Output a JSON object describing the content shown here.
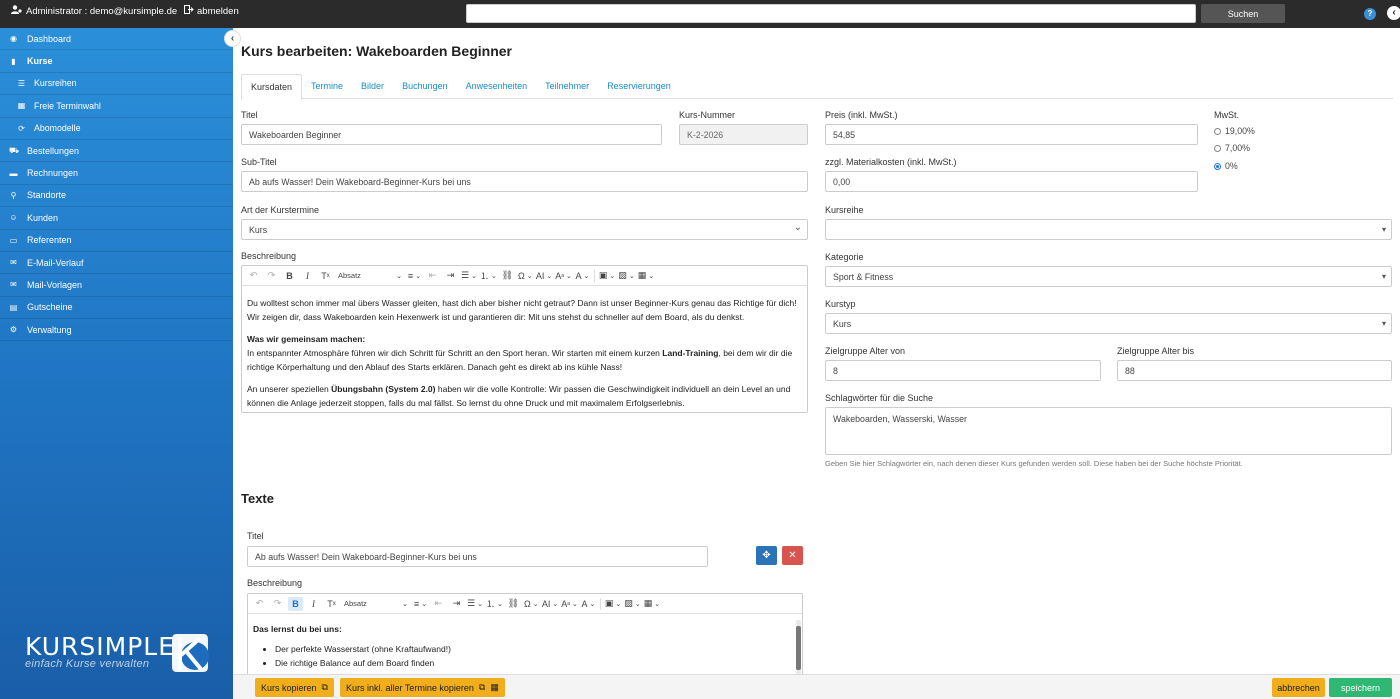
{
  "topbar": {
    "user": "Administrator : demo@kursimple.de",
    "logout": "abmelden",
    "search_placeholder": "",
    "search_button": "Suchen",
    "help_glyph": "?",
    "collapse_glyph": "‹"
  },
  "sidebar": {
    "collapse_glyph": "‹",
    "items": [
      {
        "label": "Dashboard",
        "icon": "dashboard-icon",
        "glyph": "◉"
      },
      {
        "label": "Kurse",
        "icon": "book-icon",
        "glyph": "▮"
      },
      {
        "label": "Kursreihen",
        "icon": "list-icon",
        "glyph": "☰"
      },
      {
        "label": "Freie Terminwahl",
        "icon": "calendar-icon",
        "glyph": "▦"
      },
      {
        "label": "Abomodelle",
        "icon": "refresh-icon",
        "glyph": "⟳"
      },
      {
        "label": "Bestellungen",
        "icon": "cart-icon",
        "glyph": "⛟"
      },
      {
        "label": "Rechnungen",
        "icon": "invoice-icon",
        "glyph": "▬"
      },
      {
        "label": "Standorte",
        "icon": "map-marker-icon",
        "glyph": "⚲"
      },
      {
        "label": "Kunden",
        "icon": "users-icon",
        "glyph": "☺"
      },
      {
        "label": "Referenten",
        "icon": "id-card-icon",
        "glyph": "▭"
      },
      {
        "label": "E-Mail-Verlauf",
        "icon": "envelope-icon",
        "glyph": "✉"
      },
      {
        "label": "Mail-Vorlagen",
        "icon": "inbox-icon",
        "glyph": "✉"
      },
      {
        "label": "Gutscheine",
        "icon": "ticket-icon",
        "glyph": "▤"
      },
      {
        "label": "Verwaltung",
        "icon": "gear-icon",
        "glyph": "⚙"
      }
    ],
    "logo_word": "KURSIMPLE",
    "logo_tagline": "einfach Kurse verwalten"
  },
  "page": {
    "title": "Kurs bearbeiten: Wakeboarden Beginner",
    "tabs": [
      "Kursdaten",
      "Termine",
      "Bilder",
      "Buchungen",
      "Anwesenheiten",
      "Teilnehmer",
      "Reservierungen"
    ]
  },
  "form": {
    "titel_label": "Titel",
    "titel_value": "Wakeboarden Beginner",
    "kursnummer_label": "Kurs-Nummer",
    "kursnummer_value": "K-2-2026",
    "subtitel_label": "Sub-Titel",
    "subtitel_value": "Ab aufs Wasser! Dein Wakeboard-Beginner-Kurs bei uns",
    "art_label": "Art der Kurstermine",
    "art_value": "Kurs",
    "beschreibung_label": "Beschreibung",
    "preis_label": "Preis (inkl. MwSt.)",
    "preis_value": "54,85",
    "material_label": "zzgl. Materialkosten (inkl. MwSt.)",
    "material_value": "0,00",
    "mwst_label": "MwSt.",
    "mwst_options": [
      "19,00%",
      "7,00%",
      "0%"
    ],
    "kursreihe_label": "Kursreihe",
    "kursreihe_value": "",
    "kategorie_label": "Kategorie",
    "kategorie_value": "Sport & Fitness",
    "kurstyp_label": "Kurstyp",
    "kurstyp_value": "Kurs",
    "alter_von_label": "Zielgruppe Alter von",
    "alter_von_value": "8",
    "alter_bis_label": "Zielgruppe Alter bis",
    "alter_bis_value": "88",
    "schlag_label": "Schlagwörter für die Suche",
    "schlag_value": "Wakeboarden, Wasserski, Wasser",
    "schlag_hint": "Geben Sie hier Schlagwörter ein, nach denen dieser Kurs gefunden werden soll. Diese haben bei der Suche höchste Priorität."
  },
  "editor": {
    "format": "Absatz",
    "p1": "Du wolltest schon immer mal übers Wasser gleiten, hast dich aber bisher nicht getraut? Dann ist unser Beginner-Kurs genau das Richtige für dich! Wir zeigen dir, dass Wakeboarden kein Hexenwerk ist und garantieren dir: Mit uns stehst du schneller auf dem Board, als du denkst.",
    "h2": "Was wir gemeinsam machen:",
    "p2a": "In entspannter Atmosphäre führen wir dich Schritt für Schritt an den Sport heran. Wir starten mit einem kurzen ",
    "p2b": "Land-Training",
    "p2c": ", bei dem wir dir die richtige Körperhaltung und den Ablauf des Starts erklären. Danach geht es direkt ab ins kühle Nass!",
    "p3a": "An unserer speziellen ",
    "p3b": "Übungsbahn (System 2.0)",
    "p3c": " haben wir die volle Kontrolle: Wir passen die Geschwindigkeit individuell an dein Level an und können die Anlage jederzeit stoppen, falls du mal fällst. So lernst du ohne Druck und mit maximalem Erfolgserlebnis."
  },
  "texte": {
    "section_title": "Texte",
    "titel_label": "Titel",
    "titel_value": "Ab aufs Wasser! Dein Wakeboard-Beginner-Kurs bei uns",
    "beschreibung_label": "Beschreibung",
    "format": "Absatz",
    "heading": "Das lernst du bei uns:",
    "bullets": [
      "Der perfekte Wasserstart (ohne Kraftaufwand!)",
      "Die richtige Balance auf dem Board finden"
    ]
  },
  "footer": {
    "copy": "Kurs kopieren",
    "copy_all": "Kurs inkl. aller Termine kopieren",
    "cancel": "abbrechen",
    "save": "speichern"
  }
}
